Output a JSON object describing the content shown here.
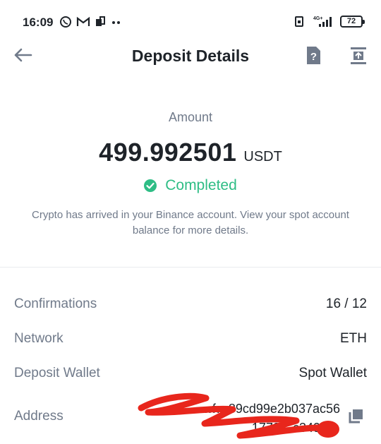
{
  "status_bar": {
    "time": "16:09",
    "network_label": "4G+",
    "battery": "72"
  },
  "header": {
    "title": "Deposit Details",
    "back_icon": "arrow-left-icon",
    "help_icon": "help-document-icon",
    "export_icon": "export-icon"
  },
  "summary": {
    "amount_label": "Amount",
    "amount": "499.992501",
    "unit": "USDT",
    "status": "Completed",
    "info": "Crypto has arrived in your Binance account. View your spot account balance for more details."
  },
  "details": [
    {
      "label": "Confirmations",
      "value": "16 / 12"
    },
    {
      "label": "Network",
      "value": "ETH"
    },
    {
      "label": "Deposit Wallet",
      "value": "Spot Wallet"
    }
  ],
  "address": {
    "label": "Address",
    "line1": "…f…89cd99e2b037ac56",
    "line2": "1779…c3491…",
    "copy_icon": "copy-icon"
  },
  "colors": {
    "success": "#2ebd85",
    "muted": "#707a8a",
    "text": "#1e2329",
    "redaction": "#e8261c"
  }
}
